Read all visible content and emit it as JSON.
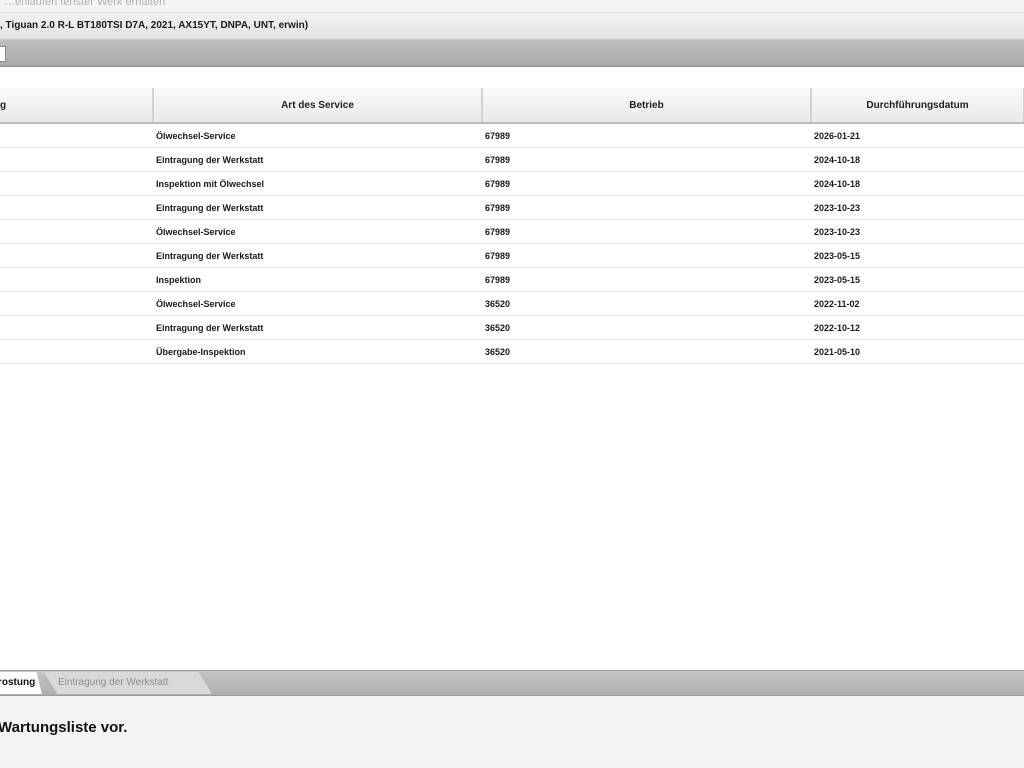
{
  "top_breadcrumb": "…enlaufen fenster Werk erhalten",
  "vehicle_info": ", Tiguan 2.0 R-L BT180TSI D7A, 2021, AX15YT, DNPA, UNT, erwin)",
  "table": {
    "headers": [
      "g",
      "Art des Service",
      "Betrieb",
      "Durchführungsdatum"
    ],
    "rows": [
      {
        "service": "Ölwechsel-Service",
        "betrieb": "67989",
        "datum": "2026-01-21"
      },
      {
        "service": "Eintragung der Werkstatt",
        "betrieb": "67989",
        "datum": "2024-10-18"
      },
      {
        "service": "Inspektion mit Ölwechsel",
        "betrieb": "67989",
        "datum": "2024-10-18"
      },
      {
        "service": "Eintragung der Werkstatt",
        "betrieb": "67989",
        "datum": "2023-10-23"
      },
      {
        "service": "Ölwechsel-Service",
        "betrieb": "67989",
        "datum": "2023-10-23"
      },
      {
        "service": "Eintragung der Werkstatt",
        "betrieb": "67989",
        "datum": "2023-05-15"
      },
      {
        "service": "Inspektion",
        "betrieb": "67989",
        "datum": "2023-05-15"
      },
      {
        "service": "Ölwechsel-Service",
        "betrieb": "36520",
        "datum": "2022-11-02"
      },
      {
        "service": "Eintragung der Werkstatt",
        "betrieb": "36520",
        "datum": "2022-10-12"
      },
      {
        "service": "Übergabe-Inspektion",
        "betrieb": "36520",
        "datum": "2021-05-10"
      }
    ]
  },
  "tabs": {
    "active": "rostung",
    "inactive": "Eintragung der Werkstatt"
  },
  "message": "Wartungsliste vor."
}
